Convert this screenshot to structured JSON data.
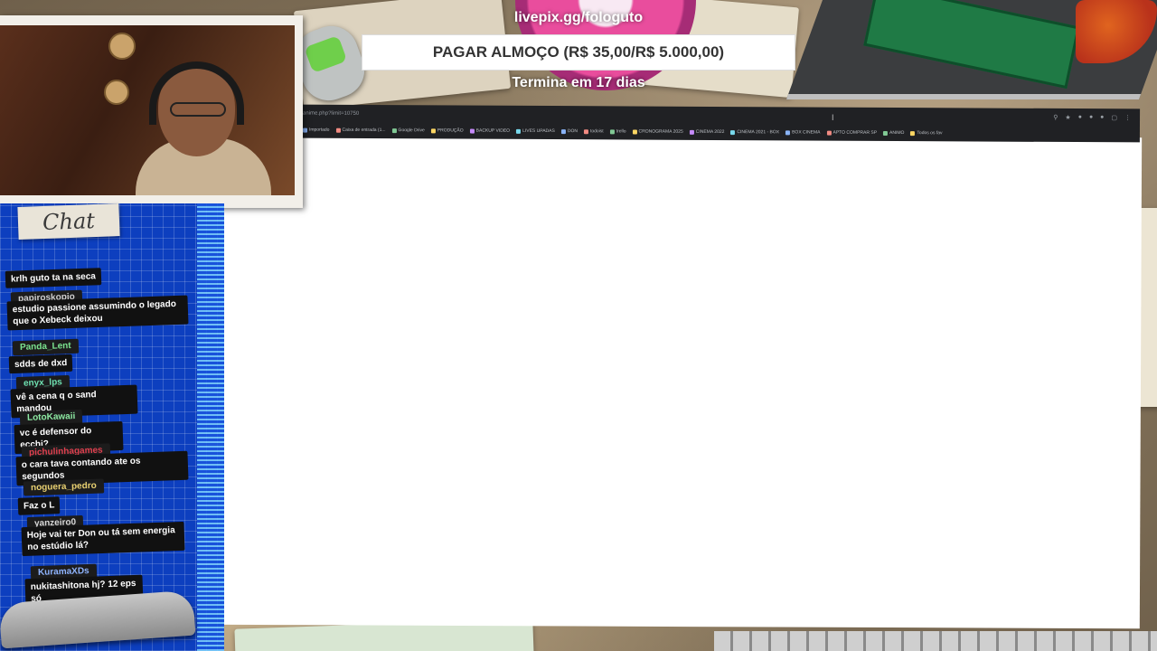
{
  "overlay": {
    "goal_url": "livepix.gg/fologuto",
    "goal_title": "PAGAR ALMOÇO (R$ 35,00/R$ 5.000,00)",
    "goal_progress_fraction": 0.007,
    "goal_deadline": "Termina em 17 dias"
  },
  "chat": {
    "title": "Chat",
    "messages": [
      {
        "user": "",
        "text": "krlh guto ta na seca",
        "user_color": "#ffffff"
      },
      {
        "user": "papiroskopio",
        "text": "estudio passione assumindo o legado que o Xebeck deixou",
        "user_color": "#cfcfcf"
      },
      {
        "user": "Panda_Lent",
        "text": "sdds de dxd",
        "user_color": "#7be38f"
      },
      {
        "user": "enyx_lps",
        "text": "vê a cena q o sand mandou",
        "user_color": "#6ee0b0"
      },
      {
        "user": "LotoKawaii",
        "text": "vc é defensor do ecchi?",
        "user_color": "#8de9a2"
      },
      {
        "user": "pichulinhagames",
        "text": "o cara tava contando ate os segundos",
        "user_color": "#e0404f"
      },
      {
        "user": "noguera_pedro",
        "text": "Faz o L",
        "user_color": "#e8d071"
      },
      {
        "user": "yanzeiro0",
        "text": "Hoje vai ter Don ou tá sem energia no estúdio lá?",
        "user_color": "#d9d9d9"
      },
      {
        "user": "KuramaXDs",
        "text": "nukitashitona hj? 12 eps só",
        "user_color": "#8fb4ff"
      }
    ]
  },
  "browser": {
    "address": "anime.php?limit=10750",
    "toolbar_icons": [
      "zoom-icon",
      "star-icon",
      "extension-icon",
      "extension-icon",
      "extension-icon",
      "extension-icon",
      "menu-icon"
    ],
    "bookmarks": [
      "Importado",
      "Caixa de entrada (1...",
      "Google Drive",
      "PRODUÇÃO",
      "BACKUP VIDEO",
      "LIVES UPADAS",
      "DON",
      "todoist",
      "trello",
      "CRONOGRAMA 2025",
      "CINEMA 2022",
      "CINEMA 2021 - BOX",
      "BOX CINEMA",
      "APTO COMPRAR SP",
      "ANIMO",
      "Todos os fav"
    ]
  },
  "colors": {
    "chat_blue": "#0d3fbf",
    "goal_bg": "#ffffff",
    "browser_chrome": "#202124"
  }
}
